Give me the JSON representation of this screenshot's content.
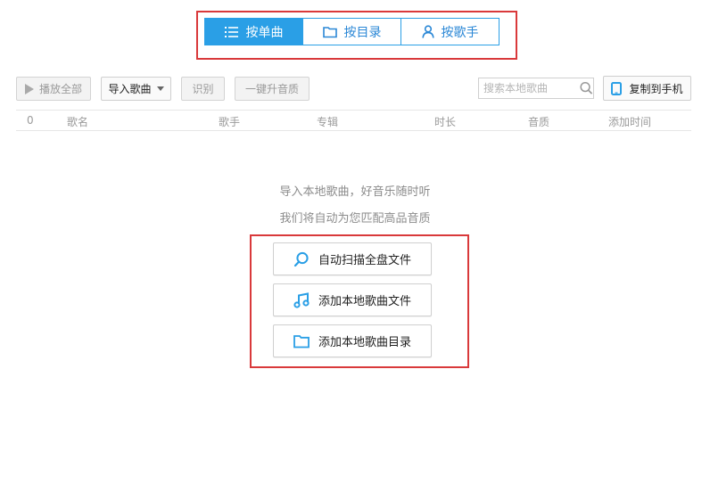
{
  "view_tabs": [
    {
      "label": "按单曲",
      "active": true
    },
    {
      "label": "按目录",
      "active": false
    },
    {
      "label": "按歌手",
      "active": false
    }
  ],
  "toolbar": {
    "play_all": "播放全部",
    "import_songs": "导入歌曲",
    "identify": "识别",
    "upgrade_quality": "一键升音质",
    "search_placeholder": "搜索本地歌曲",
    "copy_to_phone": "复制到手机"
  },
  "table_columns": [
    "0",
    "歌名",
    "歌手",
    "专辑",
    "时长",
    "音质",
    "添加时间"
  ],
  "empty_state": {
    "line1": "导入本地歌曲，好音乐随时听",
    "line2": "我们将自动为您匹配高品音质"
  },
  "actions": [
    {
      "label": "自动扫描全盘文件",
      "icon": "search-icon"
    },
    {
      "label": "添加本地歌曲文件",
      "icon": "music-note-icon"
    },
    {
      "label": "添加本地歌曲目录",
      "icon": "folder-icon"
    }
  ],
  "colors": {
    "accent": "#2a9fe6",
    "annotation_red": "#d9393b"
  }
}
